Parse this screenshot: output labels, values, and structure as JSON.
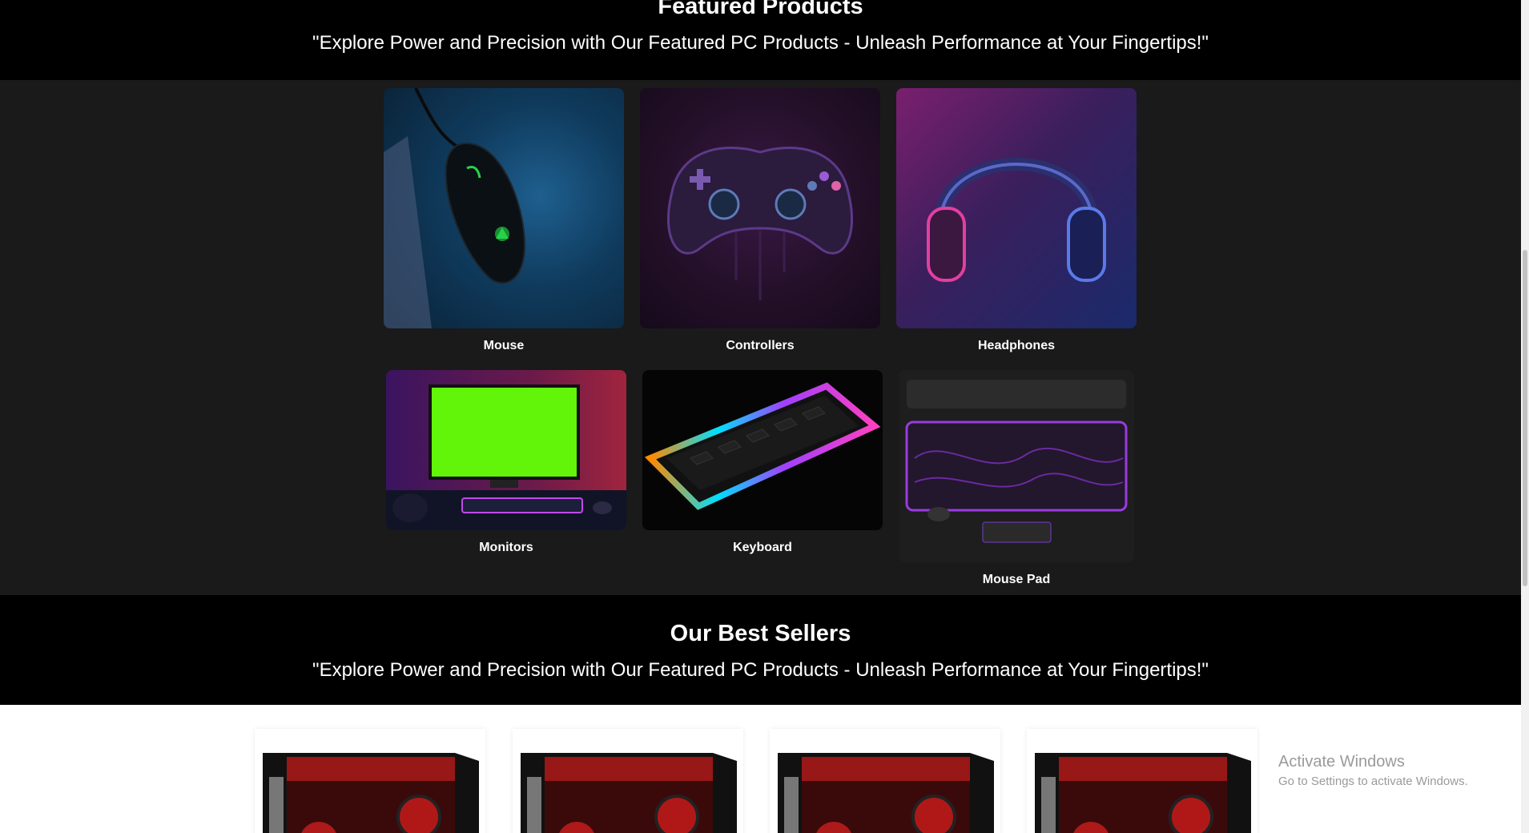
{
  "featured": {
    "title": "Featured Products",
    "subtitle": "\"Explore Power and Precision with Our Featured PC Products - Unleash Performance at Your Fingertips!\""
  },
  "products": [
    {
      "label": "Mouse",
      "icon": "gaming-mouse-image"
    },
    {
      "label": "Controllers",
      "icon": "game-controller-image"
    },
    {
      "label": "Headphones",
      "icon": "headphones-image"
    },
    {
      "label": "Monitors",
      "icon": "monitor-image"
    },
    {
      "label": "Keyboard",
      "icon": "keyboard-image"
    },
    {
      "label": "Mouse Pad",
      "icon": "mouse-pad-image"
    }
  ],
  "best_sellers": {
    "title": "Our Best Sellers",
    "subtitle": "\"Explore Power and Precision with Our Featured PC Products - Unleash Performance at Your Fingertips!\"",
    "items_icon": "pc-case-image"
  },
  "activate_windows": {
    "line1": "Activate Windows",
    "line2": "Go to Settings to activate Windows."
  },
  "colors": {
    "band": "#000000",
    "grid_bg": "#1a1a1a",
    "text": "#ffffff"
  }
}
